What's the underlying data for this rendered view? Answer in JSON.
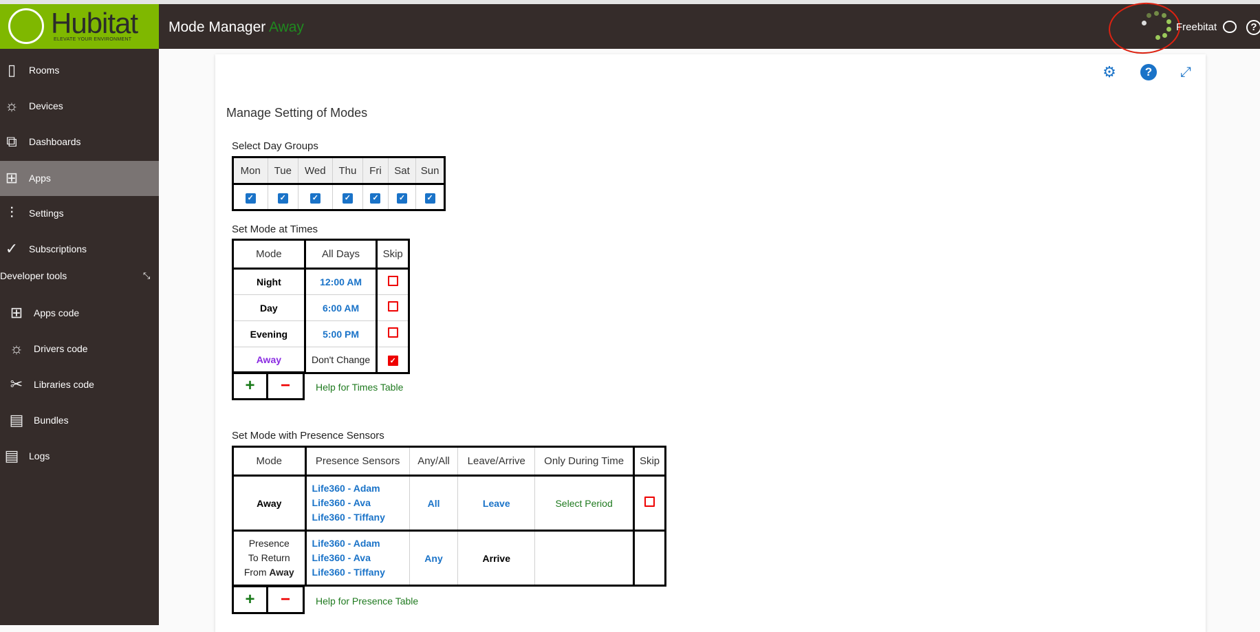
{
  "header": {
    "logo_text": "Hubitat",
    "logo_tagline": "ELEVATE YOUR ENVIRONMENT",
    "title": "Mode Manager",
    "current_mode": "Away",
    "user": "Freebitat"
  },
  "sidebar": {
    "items": [
      {
        "label": "Rooms",
        "icon": "door-icon"
      },
      {
        "label": "Devices",
        "icon": "bulb-icon"
      },
      {
        "label": "Dashboards",
        "icon": "dashboards-icon"
      },
      {
        "label": "Apps",
        "icon": "apps-icon",
        "active": true
      },
      {
        "label": "Settings",
        "icon": "sliders-icon"
      },
      {
        "label": "Subscriptions",
        "icon": "check-circle-icon"
      }
    ],
    "dev_tools_label": "Developer tools",
    "dev_items": [
      {
        "label": "Apps code",
        "icon": "apps-icon"
      },
      {
        "label": "Drivers code",
        "icon": "bulb-icon"
      },
      {
        "label": "Libraries code",
        "icon": "tools-icon"
      },
      {
        "label": "Bundles",
        "icon": "zip-icon"
      },
      {
        "label": "Logs",
        "icon": "log-icon"
      }
    ]
  },
  "main": {
    "title": "Manage Setting of Modes",
    "day_groups": {
      "label": "Select Day Groups",
      "days": [
        "Mon",
        "Tue",
        "Wed",
        "Thu",
        "Fri",
        "Sat",
        "Sun"
      ],
      "checked": [
        true,
        true,
        true,
        true,
        true,
        true,
        true
      ]
    },
    "times": {
      "label": "Set Mode at Times",
      "headers": [
        "Mode",
        "All Days",
        "Skip"
      ],
      "rows": [
        {
          "mode": "Night",
          "time": "12:00 AM",
          "skip": false
        },
        {
          "mode": "Day",
          "time": "6:00 AM",
          "skip": false
        },
        {
          "mode": "Evening",
          "time": "5:00 PM",
          "skip": false
        },
        {
          "mode": "Away",
          "time": "Don't Change",
          "skip": true
        }
      ],
      "add": "+",
      "remove": "−",
      "help": "Help for Times Table"
    },
    "presence": {
      "label": "Set Mode with Presence Sensors",
      "headers": [
        "Mode",
        "Presence Sensors",
        "Any/All",
        "Leave/Arrive",
        "Only During Time",
        "Skip"
      ],
      "rows": [
        {
          "mode": "Away",
          "sensors": [
            "Life360 - Adam",
            "Life360 - Ava",
            "Life360 - Tiffany"
          ],
          "anyall": "All",
          "leave": "Leave",
          "period": "Select Period"
        },
        {
          "mode_lines": [
            "Presence",
            "To Return",
            "From"
          ],
          "mode_bold": "Away",
          "sensors": [
            "Life360 - Adam",
            "Life360 - Ava",
            "Life360 - Tiffany"
          ],
          "anyall": "Any",
          "leave": "Arrive"
        }
      ],
      "add": "+",
      "remove": "−",
      "help": "Help for Presence Table"
    }
  },
  "colors": {
    "header": "#352c2a",
    "brand": "#7fb800",
    "accent": "#1a73c8",
    "skip": "#ee0000"
  }
}
